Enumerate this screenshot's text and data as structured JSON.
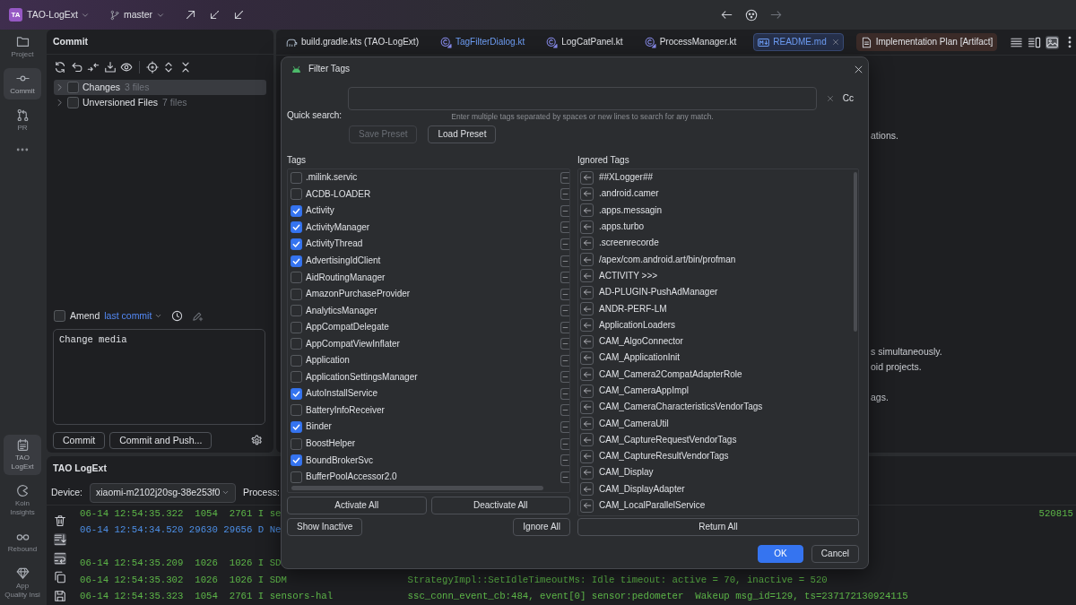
{
  "title_bar": {
    "badge": "TA",
    "project": "TAO-LogExt",
    "branch": "master"
  },
  "tool_strip": {
    "top": [
      {
        "label": "Project",
        "kind": "folder",
        "selected": false
      },
      {
        "label": "Commit",
        "kind": "commit",
        "selected": true
      },
      {
        "label": "PR",
        "kind": "pull-request",
        "selected": false
      }
    ],
    "bottom": [
      {
        "label": "TAO LogExt",
        "kind": "log",
        "selected": true
      },
      {
        "label": "Koin Insights",
        "kind": "koin",
        "selected": false
      },
      {
        "label": "Rebound",
        "kind": "glasses",
        "selected": false
      },
      {
        "label": "App Quality Insi",
        "kind": "diamond",
        "selected": false
      }
    ]
  },
  "commit_panel": {
    "title": "Commit",
    "tree": [
      {
        "label": "Changes",
        "count": "3 files",
        "checked": false,
        "expanded": false,
        "selected": true
      },
      {
        "label": "Unversioned Files",
        "count": "7 files",
        "checked": false,
        "expanded": false,
        "selected": false
      }
    ],
    "amend": {
      "checked": false,
      "label": "Amend",
      "link": "last commit"
    },
    "message": "Change media",
    "buttons": [
      "Commit",
      "Commit and Push..."
    ]
  },
  "editor": {
    "tabs": [
      {
        "label": "build.gradle.kts (TAO-LogExt)",
        "kind": "gradle",
        "selected": false,
        "modified": false
      },
      {
        "label": "TagFilterDialog.kt",
        "kind": "kotlin",
        "selected": false,
        "modified": true
      },
      {
        "label": "LogCatPanel.kt",
        "kind": "kotlin",
        "selected": false,
        "modified": false
      },
      {
        "label": "ProcessManager.kt",
        "kind": "kotlin",
        "selected": false,
        "modified": false
      },
      {
        "label": "README.md",
        "kind": "markdown",
        "selected": true,
        "modified": true
      },
      {
        "label": "Implementation Plan [Artifact]",
        "kind": "artifact",
        "selected": false,
        "modified": false,
        "color": "#3b2b28"
      }
    ],
    "view_modes": [
      {
        "kind": "editor",
        "selected": false
      },
      {
        "kind": "split",
        "selected": false
      },
      {
        "kind": "preview",
        "selected": true
      }
    ],
    "readme_fragments": [
      "ations.",
      "s simultaneously.",
      "oid projects.",
      "ags."
    ]
  },
  "dialog": {
    "title": "Filter Tags",
    "search_label": "Quick search:",
    "case_toggle": "Cc",
    "hint": "Enter multiple tags separated by spaces or new lines to search for any match.",
    "preset_buttons": [
      {
        "label": "Save Preset",
        "disabled": true
      },
      {
        "label": "Load Preset",
        "disabled": false
      }
    ],
    "tags": {
      "heading": "Tags",
      "items": [
        {
          "label": ".milink.servic",
          "checked": false
        },
        {
          "label": "ACDB-LOADER",
          "checked": false
        },
        {
          "label": "Activity",
          "checked": true
        },
        {
          "label": "ActivityManager",
          "checked": true
        },
        {
          "label": "ActivityThread",
          "checked": true
        },
        {
          "label": "AdvertisingIdClient",
          "checked": true
        },
        {
          "label": "AidRoutingManager",
          "checked": false
        },
        {
          "label": "AmazonPurchaseProvider",
          "checked": false
        },
        {
          "label": "AnalyticsManager",
          "checked": false
        },
        {
          "label": "AppCompatDelegate",
          "checked": false
        },
        {
          "label": "AppCompatViewInflater",
          "checked": false
        },
        {
          "label": "Application",
          "checked": false
        },
        {
          "label": "ApplicationSettingsManager",
          "checked": false
        },
        {
          "label": "AutoInstallService",
          "checked": true
        },
        {
          "label": "BatteryInfoReceiver",
          "checked": false
        },
        {
          "label": "Binder",
          "checked": true
        },
        {
          "label": "BoostHelper",
          "checked": false
        },
        {
          "label": "BoundBrokerSvc",
          "checked": true
        },
        {
          "label": "BufferPoolAccessor2.0",
          "checked": false
        }
      ]
    },
    "ignored": {
      "heading": "Ignored Tags",
      "items": [
        {
          "label": "##XLogger##"
        },
        {
          "label": ".android.camer"
        },
        {
          "label": ".apps.messagin"
        },
        {
          "label": ".apps.turbo"
        },
        {
          "label": ".screenrecorde"
        },
        {
          "label": "/apex/com.android.art/bin/profman"
        },
        {
          "label": "ACTIVITY >>>"
        },
        {
          "label": "AD-PLUGIN-PushAdManager"
        },
        {
          "label": "ANDR-PERF-LM"
        },
        {
          "label": "ApplicationLoaders"
        },
        {
          "label": "CAM_AlgoConnector"
        },
        {
          "label": "CAM_ApplicationInit"
        },
        {
          "label": "CAM_Camera2CompatAdapterRole"
        },
        {
          "label": "CAM_CameraAppImpl"
        },
        {
          "label": "CAM_CameraCharacteristicsVendorTags"
        },
        {
          "label": "CAM_CameraUtil"
        },
        {
          "label": "CAM_CaptureRequestVendorTags"
        },
        {
          "label": "CAM_CaptureResultVendorTags"
        },
        {
          "label": "CAM_Display"
        },
        {
          "label": "CAM_DisplayAdapter"
        },
        {
          "label": "CAM_LocalParallelService"
        }
      ]
    },
    "tag_buttons": [
      "Activate All",
      "Deactivate All"
    ],
    "show_inactive": "Show Inactive",
    "ignore_all": "Ignore All",
    "return_all": "Return All",
    "footer": [
      {
        "label": "OK",
        "kind": "primary"
      },
      {
        "label": "Cancel",
        "kind": "secondary"
      }
    ]
  },
  "log_panel": {
    "title": "TAO LogExt",
    "device_label": "Device:",
    "device": "xiaomi-m2102j20sg-38e253f0",
    "process_label": "Process:",
    "toolbar": [
      {
        "kind": "clear",
        "on": false
      },
      {
        "kind": "scroll-to-end",
        "on": true
      },
      {
        "kind": "soft-wrap",
        "on": true
      },
      {
        "kind": "copy",
        "on": false
      },
      {
        "kind": "save",
        "on": false
      }
    ],
    "rows": [
      {
        "kind": "info",
        "time": "06-14 12:54:35.322",
        "pid": "1054",
        "tid": "2761",
        "priority": "I",
        "tag": "se",
        "tail": "520815"
      },
      {
        "kind": "debug",
        "time": "06-14 12:54:34.520",
        "pid": "29630",
        "tid": "29656",
        "priority": "D",
        "tag": "Ne"
      },
      {
        "kind": "info",
        "time": "06-14 12:54:35.209",
        "pid": "1026",
        "tid": "1026",
        "priority": "I",
        "tag": "SD"
      },
      {
        "kind": "info",
        "time": "06-14 12:54:35.302",
        "pid": "1026",
        "tid": "1026",
        "priority": "I",
        "tag": "SDM",
        "message": "StrategyImpl::SetIdleTimeoutMs: Idle timeout: active = 70, inactive = 520"
      },
      {
        "kind": "info",
        "time": "06-14 12:54:35.323",
        "pid": "1054",
        "tid": "2761",
        "priority": "I",
        "tag": "sensors-hal",
        "message": "ssc_conn_event_cb:484, event[0] sensor:pedometer  Wakeup msg_id=129, ts=237172130924115"
      }
    ]
  }
}
